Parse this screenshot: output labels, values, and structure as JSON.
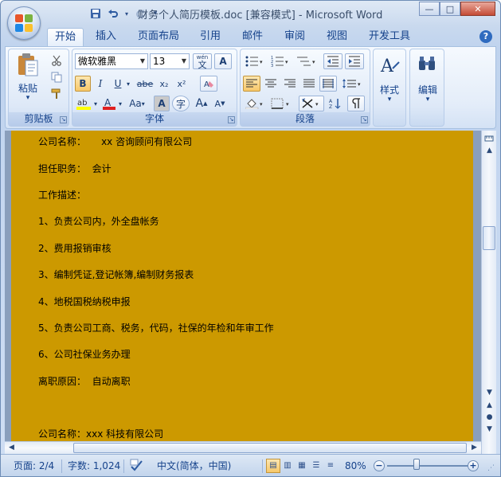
{
  "window": {
    "title": "财务个人简历模板.doc [兼容模式] - Microsoft Word",
    "minimize": "—",
    "maximize": "□",
    "close": "✕"
  },
  "qat": {
    "save_icon": "save-icon",
    "undo_icon": "undo-icon",
    "redo_icon": "redo-icon",
    "customize_icon": "dropdown-icon"
  },
  "tabs": [
    "开始",
    "插入",
    "页面布局",
    "引用",
    "邮件",
    "审阅",
    "视图",
    "开发工具"
  ],
  "active_tab": "开始",
  "ribbon": {
    "clipboard": {
      "label": "剪贴板",
      "paste": "粘贴",
      "paste_arrow": "▾"
    },
    "font": {
      "label": "字体",
      "font_name": "微软雅黑",
      "font_size": "13",
      "bold": "B",
      "italic": "I",
      "underline": "U",
      "strike": "abe",
      "subscript": "x₂",
      "superscript": "x²",
      "grow": "A",
      "shrink": "A",
      "change_case": "Aa",
      "char_shade": "A",
      "enclose": "字",
      "phonetic": "wén",
      "phonetic_char": "文"
    },
    "paragraph": {
      "label": "段落"
    },
    "styles": {
      "label": "样式",
      "arrow": "▾"
    },
    "editing": {
      "label": "编辑",
      "arrow": "▾"
    }
  },
  "document": {
    "lines": [
      "公司名称：     xx 咨询顾问有限公司",
      "担任职务：  会计",
      "工作描述：",
      "1、负责公司内，外全盘帐务",
      "2、费用报销审核",
      "3、编制凭证,登记帐簿,编制财务报表",
      "4、地税国税纳税申报",
      "5、负责公司工商、税务，代码，社保的年检和年审工作",
      "6、公司社保业务办理",
      "离职原因：  自动离职",
      "",
      "公司名称：xxx 科技有限公司"
    ],
    "page_color": "#cc9900"
  },
  "statusbar": {
    "page": "页面: 2/4",
    "words": "字数: 1,024",
    "language": "中文(简体，中国)",
    "zoom": "80%",
    "zoom_minus": "−",
    "zoom_plus": "+"
  }
}
